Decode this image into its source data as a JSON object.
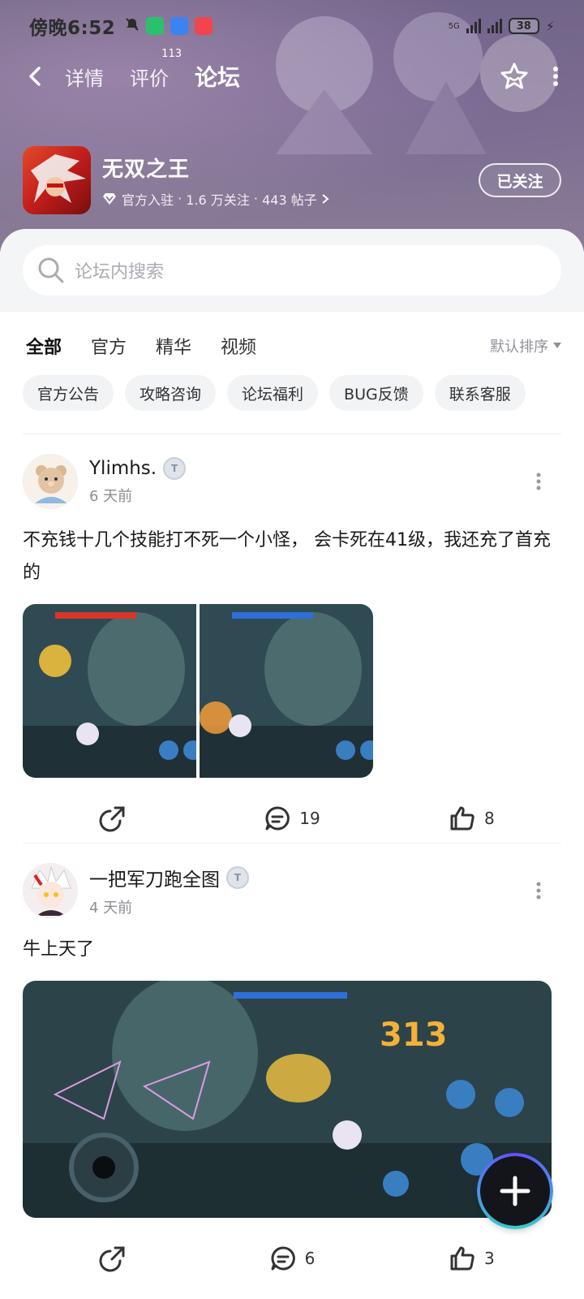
{
  "status_bar": {
    "time": "傍晚6:52",
    "network": "5G",
    "battery": "38"
  },
  "nav": {
    "tabs": [
      {
        "label": "详情"
      },
      {
        "label": "评价",
        "badge": "113"
      },
      {
        "label": "论坛"
      }
    ],
    "active_tab": "论坛"
  },
  "game": {
    "title": "无双之王",
    "official": "官方入驻",
    "followers": "1.6 万关注",
    "posts": "443 帖子",
    "follow_label": "已关注"
  },
  "search": {
    "placeholder": "论坛内搜索"
  },
  "filter_tabs": [
    "全部",
    "官方",
    "精华",
    "视频"
  ],
  "sort_label": "默认排序",
  "chips": [
    "官方公告",
    "攻略咨询",
    "论坛福利",
    "BUG反馈",
    "联系客服"
  ],
  "posts": [
    {
      "author": "Ylimhs.",
      "time": "6 天前",
      "text": "不充钱十几个技能打不死一个小怪， 会卡死在41级，我还充了首充的",
      "comments": "19",
      "likes": "8"
    },
    {
      "author": "一把军刀跑全图",
      "time": "4 天前",
      "text": "牛上天了",
      "comments": "6",
      "likes": "3"
    }
  ],
  "colors": {
    "accent": "#20d4c4",
    "hero": "#7b6f8f"
  }
}
